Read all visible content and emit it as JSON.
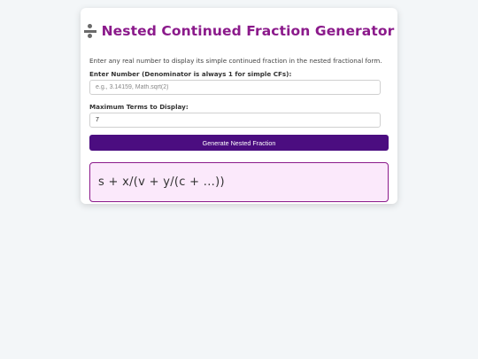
{
  "header": {
    "icon": "divide-icon",
    "title": "Nested Continued Fraction Generator"
  },
  "description": "Enter any real number to display its simple continued fraction in the nested fractional form.",
  "number_field": {
    "label": "Enter Number (Denominator is always 1 for simple CFs):",
    "value": "",
    "placeholder": "e.g., 3.14159, Math.sqrt(2)"
  },
  "terms_field": {
    "label": "Maximum Terms to Display:",
    "value": "7",
    "placeholder": ""
  },
  "generate_button": {
    "label": "Generate Nested Fraction"
  },
  "output": {
    "text": "s + x/(v + y/(c + ...))"
  },
  "colors": {
    "accent": "#8b1a8b",
    "button": "#4b0d80",
    "output_bg": "#fbe9fb",
    "page_bg": "#f3f6f8"
  }
}
